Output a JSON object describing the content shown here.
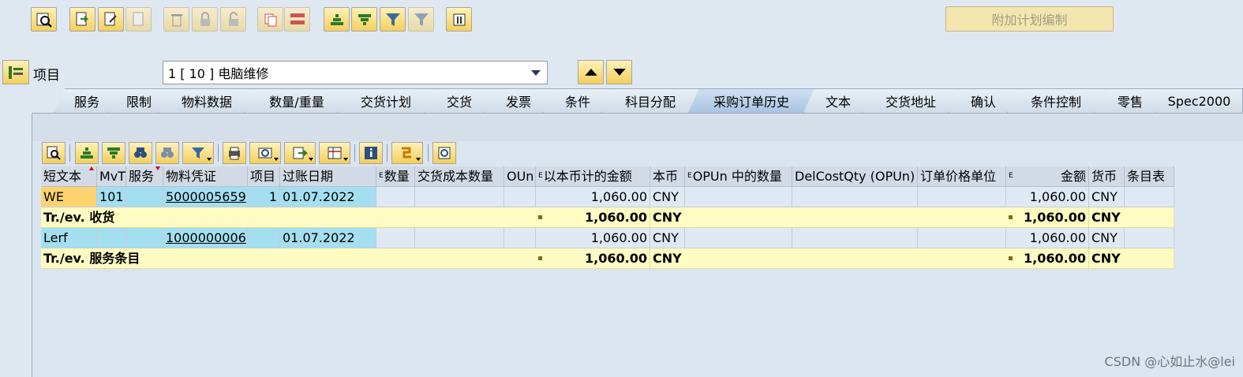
{
  "extra_button": "附加计划编制",
  "item": {
    "label": "项目",
    "value": "1 [ 10 ] 电脑维修"
  },
  "tabs": [
    "服务",
    "限制",
    "物料数据",
    "数量/重量",
    "交货计划",
    "交货",
    "发票",
    "条件",
    "科目分配",
    "采购订单历史",
    "文本",
    "交货地址",
    "确认",
    "条件控制",
    "零售",
    "Spec2000"
  ],
  "active_tab": "采购订单历史",
  "columns": [
    "短文本",
    "MvT",
    "服务",
    "物料凭证",
    "项目",
    "过账日期",
    "数量",
    "交货成本数量",
    "OUn",
    "以本币计的金额",
    "本币",
    "OPUn 中的数量",
    "DelCostQty (OPUn)",
    "订单价格单位",
    "金额",
    "货币",
    "条目表"
  ],
  "rows": [
    {
      "type": "data",
      "short": "WE",
      "mvt": "101",
      "service": "",
      "matdoc": "5000005659",
      "item": "1",
      "date": "01.07.2022",
      "qty": "",
      "delcost": "",
      "oun": "",
      "amount_local": "1,060.00",
      "local_curr": "CNY",
      "opun_qty": "",
      "delcost_opun": "",
      "price_unit": "",
      "amount": "1,060.00",
      "currency": "CNY",
      "entry": ""
    },
    {
      "type": "sum",
      "label": "Tr./ev. 收货",
      "amount_local": "1,060.00",
      "local_curr": "CNY",
      "amount": "1,060.00",
      "currency": "CNY"
    },
    {
      "type": "data",
      "short": "Lerf",
      "mvt": "",
      "service": "",
      "matdoc": "1000000006",
      "item": "",
      "date": "01.07.2022",
      "qty": "",
      "delcost": "",
      "oun": "",
      "amount_local": "1,060.00",
      "local_curr": "CNY",
      "opun_qty": "",
      "delcost_opun": "",
      "price_unit": "",
      "amount": "1,060.00",
      "currency": "CNY",
      "entry": ""
    },
    {
      "type": "sum",
      "label": "Tr./ev. 服务条目",
      "amount_local": "1,060.00",
      "local_curr": "CNY",
      "amount": "1,060.00",
      "currency": "CNY"
    }
  ],
  "watermark": "CSDN @心如止水@lei"
}
